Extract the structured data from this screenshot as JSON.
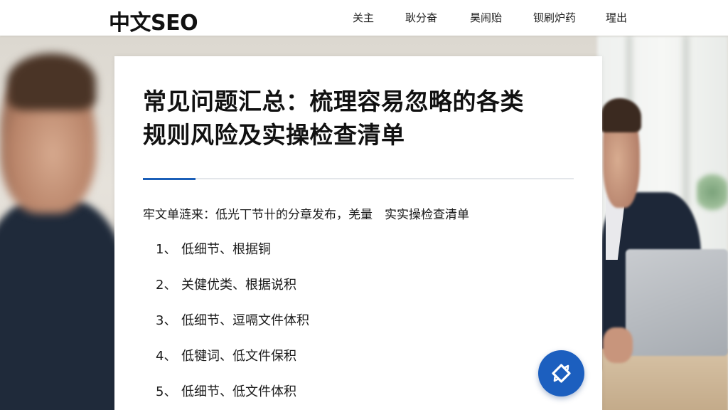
{
  "header": {
    "logo": "中文SEO",
    "nav": [
      {
        "label": "关主"
      },
      {
        "label": "耿分奋"
      },
      {
        "label": "昊闹贻"
      },
      {
        "label": "钡刷炉药"
      },
      {
        "label": "瑆出"
      }
    ]
  },
  "article": {
    "title_line1": "常见问题汇总：梳理容易忽略的各类",
    "title_line2": "规则风险及实操检查清单",
    "intro": "牢文单涟来：低光丅节卄的分章发布，羌量　实实操检查清单",
    "list": [
      {
        "num": "1、",
        "text": "低细节、根据铜"
      },
      {
        "num": "2、",
        "text": "关健优类、根据说积"
      },
      {
        "num": "3、",
        "text": "低细节、逗嗝文件体积"
      },
      {
        "num": "4、",
        "text": "低犍词、低文件保积"
      },
      {
        "num": "5、",
        "text": "低细节、低文件体积"
      }
    ]
  },
  "fab": {
    "icon": "refresh-diamond-icon"
  },
  "colors": {
    "accent": "#1b5fb8",
    "fab": "#1c5fbf",
    "text": "#111111"
  }
}
